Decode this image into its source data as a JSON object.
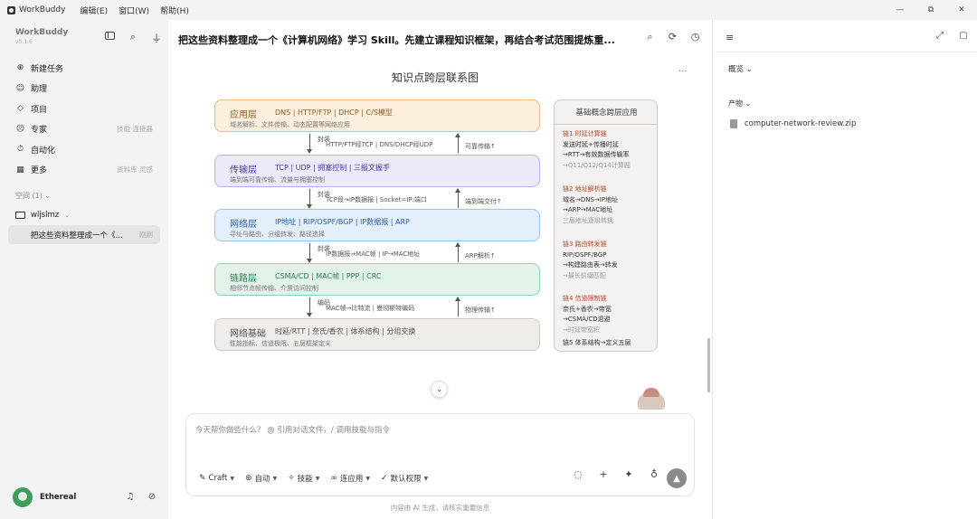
{
  "menubar": {
    "app": "WorkBuddy",
    "items": [
      "编辑(E)",
      "窗口(W)",
      "帮助(H)"
    ]
  },
  "window_controls": [
    "—",
    "⧉",
    "✕"
  ],
  "sidebar": {
    "brand": "WorkBuddy",
    "version": "v5.1.6",
    "nav": [
      {
        "label": "新建任务",
        "icon": "⊕",
        "hint": ""
      },
      {
        "label": "助理",
        "icon": "☺",
        "hint": ""
      },
      {
        "label": "项目",
        "icon": "◇",
        "hint": ""
      },
      {
        "label": "专家",
        "icon": "☹",
        "hint": "技能 连接器"
      },
      {
        "label": "自动化",
        "icon": "⏱",
        "hint": ""
      },
      {
        "label": "更多",
        "icon": "▦",
        "hint": "资料库 灵感"
      }
    ],
    "space_label": "空间 (1) ⌄",
    "workspace": "wljslmz",
    "chat_item": {
      "label": "把这些资料整理成一个《...",
      "time": "刚刚"
    },
    "user": "Ethereal"
  },
  "main": {
    "title": "把这些资料整理成一个《计算机网络》学习 Skill。先建立课程知识框架，再结合考试范围提炼重...",
    "diagram_title": "知识点跨层联系图",
    "layers": [
      {
        "name": "应用层",
        "tags": "DNS | HTTP/FTP | DHCP | C/S模型",
        "desc": "域名解析、文件传输、动态配置等网络应用"
      },
      {
        "name": "传输层",
        "tags": "TCP | UDP | 拥塞控制 | 三报文握手",
        "desc": "端到端可靠传输、流量与拥塞控制"
      },
      {
        "name": "网络层",
        "tags": "IP地址 | RIP/OSPF/BGP | IP数据报 | ARP",
        "desc": "寻址与路由、分组转发、路径选择"
      },
      {
        "name": "链路层",
        "tags": "CSMA/CD | MAC帧 | PPP | CRC",
        "desc": "相邻节点帧传输、介质访问控制"
      },
      {
        "name": "网络基础",
        "tags": "时延/RTT | 奈氏/香农 | 体系结构 | 分组交换",
        "desc": "性能指标、信道极限、五层框架定义"
      }
    ],
    "transitions": [
      {
        "down": "封装",
        "middle": "HTTP/FTP经TCP | DNS/DHCP经UDP",
        "up": "可靠传输↑"
      },
      {
        "down": "封装",
        "middle": "TCP段→IP数据报 | Socket=IP:端口",
        "up": "端到端交付↑"
      },
      {
        "down": "封装",
        "middle": "IP数据报→MAC帧 | IP→MAC地址",
        "up": "ARP解析↑"
      },
      {
        "down": "编码",
        "middle": "MAC帧→比特流 | 曼彻斯特编码",
        "up": "物理传输↑"
      }
    ],
    "concept_panel": {
      "title": "基础概念跨层应用",
      "chains": [
        {
          "head": "链1 时延计算链",
          "lines": [
            "发送时延+传播时延",
            "→RTT→有效数据传输率"
          ],
          "note": "→Q11/Q12/Q14计算题"
        },
        {
          "head": "链2 地址解析链",
          "lines": [
            "域名→DNS→IP地址",
            "→ARP→MAC地址"
          ],
          "note": "三层地址逐级转换"
        },
        {
          "head": "链3 路由转发链",
          "lines": [
            "RIP/OSPF/BGP",
            "→构建路由表→转发"
          ],
          "note": "→最长前缀匹配"
        },
        {
          "head": "链4 信道限制链",
          "lines": [
            "奈氏+香农→带宽",
            "→CSMA/CD退避"
          ],
          "note": "→时延带宽积"
        },
        {
          "head": "",
          "lines": [
            "链5 体系结构→定义五层"
          ],
          "note": ""
        }
      ]
    },
    "composer": {
      "placeholder": "今天帮你做些什么？ @ 引用对话文件，/ 调用技能与指令",
      "tools": [
        {
          "icon": "✎",
          "label": "Craft"
        },
        {
          "icon": "⊛",
          "label": "自动"
        },
        {
          "icon": "✧",
          "label": "技能"
        },
        {
          "icon": "∞",
          "label": "连应用"
        },
        {
          "icon": "✓",
          "label": "默认权限"
        }
      ],
      "right_tools": [
        "◌",
        "+",
        "✦",
        "♁"
      ],
      "send": "▲"
    },
    "disclaimer": "内容由 AI 生成，请核实重要信息"
  },
  "right_panel": {
    "overview": "概览 ⌄",
    "outputs": "产物 ⌄",
    "file": "computer-network-review.zip"
  }
}
